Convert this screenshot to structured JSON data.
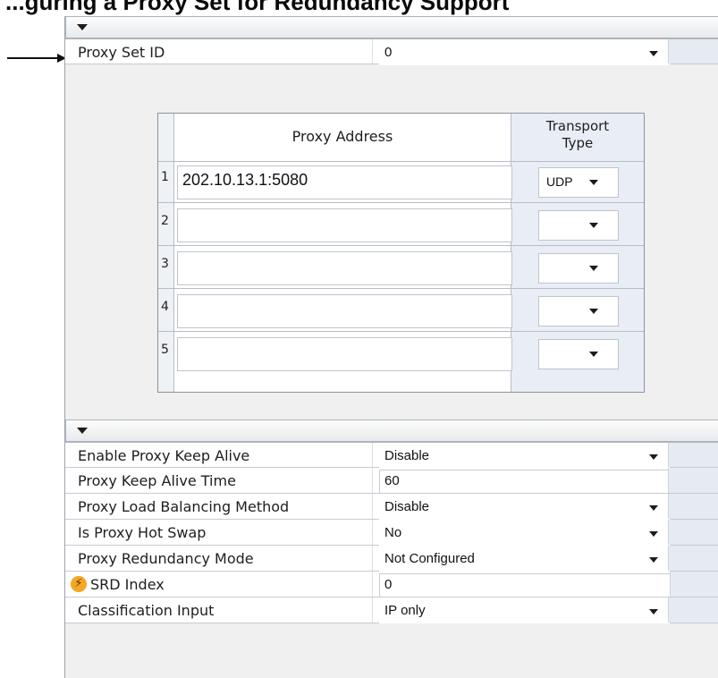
{
  "caption": "...guring a Proxy Set for Redundancy Support",
  "proxy_set": {
    "label": "Proxy Set ID",
    "value": "0"
  },
  "proxy_table": {
    "headers": {
      "address": "Proxy Address",
      "transport_line1": "Transport",
      "transport_line2": "Type"
    },
    "rows": [
      {
        "index": "1",
        "address": "202.10.13.1:5080",
        "transport": "UDP"
      },
      {
        "index": "2",
        "address": "",
        "transport": ""
      },
      {
        "index": "3",
        "address": "",
        "transport": ""
      },
      {
        "index": "4",
        "address": "",
        "transport": ""
      },
      {
        "index": "5",
        "address": "",
        "transport": ""
      }
    ]
  },
  "settings": [
    {
      "label": "Enable Proxy Keep Alive",
      "value": "Disable",
      "type": "select"
    },
    {
      "label": "Proxy Keep Alive Time",
      "value": "60",
      "type": "text"
    },
    {
      "label": "Proxy Load Balancing Method",
      "value": "Disable",
      "type": "select"
    },
    {
      "label": "Is Proxy Hot Swap",
      "value": "No",
      "type": "select"
    },
    {
      "label": "Proxy Redundancy Mode",
      "value": "Not Configured",
      "type": "select"
    },
    {
      "label": "SRD Index",
      "value": "0",
      "type": "text",
      "icon": "lightning-icon"
    },
    {
      "label": "Classification Input",
      "value": "IP only",
      "type": "select"
    }
  ],
  "colors": {
    "panel_bg": "#f0f0f0",
    "row_tail": "#e6ebf3",
    "srd_icon": "#f5a623"
  }
}
